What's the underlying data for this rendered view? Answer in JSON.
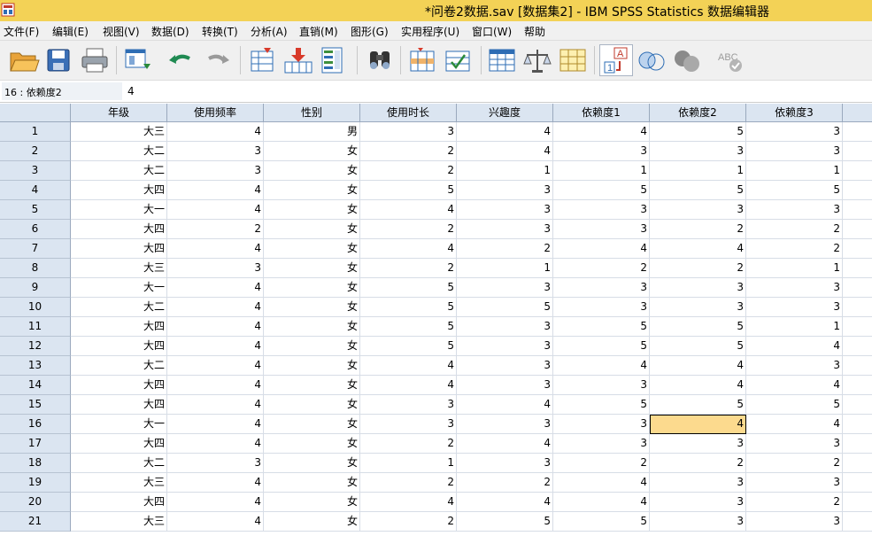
{
  "window": {
    "title": "*问卷2数据.sav [数据集2] - IBM SPSS Statistics 数据编辑器"
  },
  "menu": [
    "文件(F)",
    "编辑(E)",
    "视图(V)",
    "数据(D)",
    "转换(T)",
    "分析(A)",
    "直销(M)",
    "图形(G)",
    "实用程序(U)",
    "窗口(W)",
    "帮助"
  ],
  "toolbar": [
    "open-icon",
    "save-icon",
    "print-icon",
    "dialog-recall-icon",
    "undo-icon",
    "redo-icon",
    "goto-case-icon",
    "goto-variable-icon",
    "variables-icon",
    "find-icon",
    "insert-cases-icon",
    "insert-variable-icon",
    "split-file-icon",
    "weight-cases-icon",
    "select-cases-icon",
    "value-labels-icon",
    "use-sets-icon",
    "show-all-variables-icon",
    "spell-check-icon"
  ],
  "editbar": {
    "cell_ref": "16 : 依赖度2",
    "cell_value": "4"
  },
  "columns": [
    "年级",
    "使用频率",
    "性别",
    "使用时长",
    "兴趣度",
    "依赖度1",
    "依赖度2",
    "依赖度3"
  ],
  "rows": [
    [
      "1",
      "大三",
      "4",
      "男",
      "3",
      "4",
      "4",
      "5",
      "3"
    ],
    [
      "2",
      "大二",
      "3",
      "女",
      "2",
      "4",
      "3",
      "3",
      "3"
    ],
    [
      "3",
      "大二",
      "3",
      "女",
      "2",
      "1",
      "1",
      "1",
      "1"
    ],
    [
      "4",
      "大四",
      "4",
      "女",
      "5",
      "3",
      "5",
      "5",
      "5"
    ],
    [
      "5",
      "大一",
      "4",
      "女",
      "4",
      "3",
      "3",
      "3",
      "3"
    ],
    [
      "6",
      "大四",
      "2",
      "女",
      "2",
      "3",
      "3",
      "2",
      "2"
    ],
    [
      "7",
      "大四",
      "4",
      "女",
      "4",
      "2",
      "4",
      "4",
      "2"
    ],
    [
      "8",
      "大三",
      "3",
      "女",
      "2",
      "1",
      "2",
      "2",
      "1"
    ],
    [
      "9",
      "大一",
      "4",
      "女",
      "5",
      "3",
      "3",
      "3",
      "3"
    ],
    [
      "10",
      "大二",
      "4",
      "女",
      "5",
      "5",
      "3",
      "3",
      "3"
    ],
    [
      "11",
      "大四",
      "4",
      "女",
      "5",
      "3",
      "5",
      "5",
      "1"
    ],
    [
      "12",
      "大四",
      "4",
      "女",
      "5",
      "3",
      "5",
      "5",
      "4"
    ],
    [
      "13",
      "大二",
      "4",
      "女",
      "4",
      "3",
      "4",
      "4",
      "3"
    ],
    [
      "14",
      "大四",
      "4",
      "女",
      "4",
      "3",
      "3",
      "4",
      "4"
    ],
    [
      "15",
      "大四",
      "4",
      "女",
      "3",
      "4",
      "5",
      "5",
      "5"
    ],
    [
      "16",
      "大一",
      "4",
      "女",
      "3",
      "3",
      "3",
      "4",
      "4"
    ],
    [
      "17",
      "大四",
      "4",
      "女",
      "2",
      "4",
      "3",
      "3",
      "3"
    ],
    [
      "18",
      "大二",
      "3",
      "女",
      "1",
      "3",
      "2",
      "2",
      "2"
    ],
    [
      "19",
      "大三",
      "4",
      "女",
      "2",
      "2",
      "4",
      "3",
      "3"
    ],
    [
      "20",
      "大四",
      "4",
      "女",
      "4",
      "4",
      "4",
      "3",
      "2"
    ],
    [
      "21",
      "大三",
      "4",
      "女",
      "2",
      "5",
      "5",
      "3",
      "3"
    ]
  ],
  "selected_cell": {
    "row": "16",
    "column": "依赖度2"
  },
  "colors": {
    "titlebar": "#f3d256",
    "header_bg": "#dbe5f1",
    "selected_cell": "#fcda8e"
  }
}
